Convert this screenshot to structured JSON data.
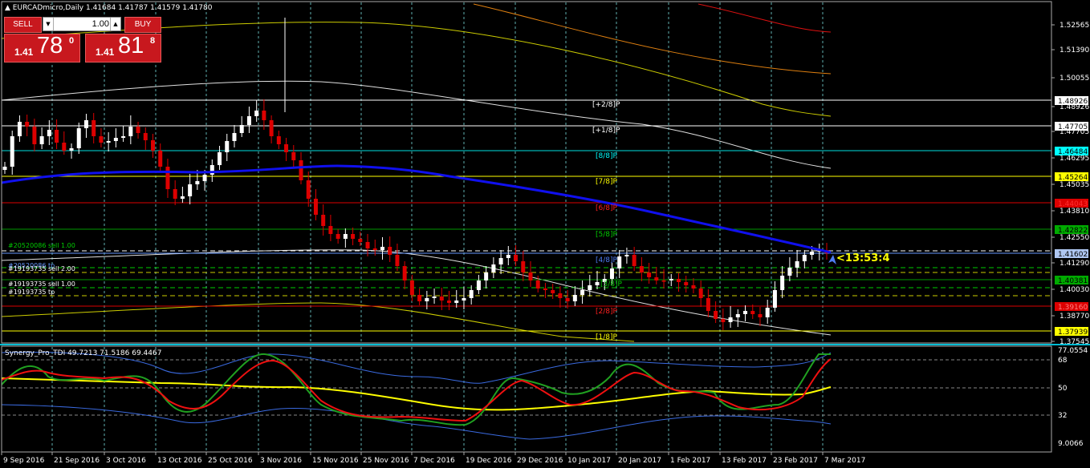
{
  "header": {
    "symbol_label": "EURCADmicro,Daily",
    "ohlc": "1.41684 1.41787 1.41579 1.41780"
  },
  "trade_panel": {
    "sell_label": "SELL",
    "buy_label": "BUY",
    "lot": "1.00",
    "sell_prefix": "1.41",
    "sell_big": "78",
    "sell_sup": "0",
    "buy_prefix": "1.41",
    "buy_big": "81",
    "buy_sup": "8"
  },
  "price_axis": {
    "ticks": [
      "1.52565",
      "1.51390",
      "1.50055",
      "1.48926",
      "1.47705",
      "1.46295",
      "1.45035",
      "1.43810",
      "1.42550",
      "1.41290",
      "1.40030",
      "1.38770",
      "1.37545"
    ],
    "badges": [
      {
        "label": "1.48926",
        "bg": "#ffffff",
        "fg": "#000000"
      },
      {
        "label": "1.47705",
        "bg": "#ffffff",
        "fg": "#000000"
      },
      {
        "label": "1.46484",
        "bg": "#00ffff",
        "fg": "#000000"
      },
      {
        "label": "1.45264",
        "bg": "#ffff00",
        "fg": "#000000"
      },
      {
        "label": "1.44043",
        "bg": "#dd0000",
        "fg": "#ff3030"
      },
      {
        "label": "1.42822",
        "bg": "#00aa00",
        "fg": "#000000"
      },
      {
        "label": "1.41602",
        "bg": "#aec6f0",
        "fg": "#000000"
      },
      {
        "label": "1.40381",
        "bg": "#00aa00",
        "fg": "#000000"
      },
      {
        "label": "1.39160",
        "bg": "#dd0000",
        "fg": "#ff8080"
      },
      {
        "label": "1.37939",
        "bg": "#ffff00",
        "fg": "#000000"
      }
    ]
  },
  "murrey_levels": [
    {
      "label": "[+2/8]P",
      "color": "#ffffff"
    },
    {
      "label": "[+1/8]P",
      "color": "#ffffff"
    },
    {
      "label": "[8/8]P",
      "color": "#00ffff"
    },
    {
      "label": "[7/8]P",
      "color": "#ffff00"
    },
    {
      "label": "[6/8]P",
      "color": "#ff2020"
    },
    {
      "label": "[5/8]P",
      "color": "#00cc00"
    },
    {
      "label": "[4/8]P",
      "color": "#4f7cf0"
    },
    {
      "label": "[3/8]P",
      "color": "#00cc00"
    },
    {
      "label": "[2/8]P",
      "color": "#ff2020"
    },
    {
      "label": "[1/8]P",
      "color": "#ffff00"
    }
  ],
  "order_labels": [
    {
      "label": "#20520086 sell 1.00",
      "color": "#00cc00"
    },
    {
      "label": "#20520086 tp",
      "color": "#6699ff"
    },
    {
      "label": "#19193735 sell 2.00",
      "color": "#ffffff"
    },
    {
      "label": "#19193735 sell 1.00",
      "color": "#ffffff"
    },
    {
      "label": "#19193735 tp",
      "color": "#ffffff"
    }
  ],
  "countdown": "<13:53:4",
  "indicator": {
    "label": "Synergy_Pro_TDI 49.7213 71.5186 69.4467",
    "ticks": [
      "77.0554",
      "68",
      "50",
      "32",
      "9.0066"
    ]
  },
  "time_axis": [
    "9 Sep 2016",
    "21 Sep 2016",
    "3 Oct 2016",
    "13 Oct 2016",
    "25 Oct 2016",
    "3 Nov 2016",
    "15 Nov 2016",
    "25 Nov 2016",
    "7 Dec 2016",
    "19 Dec 2016",
    "29 Dec 2016",
    "10 Jan 2017",
    "20 Jan 2017",
    "1 Feb 2017",
    "13 Feb 2017",
    "23 Feb 2017",
    "7 Mar 2017"
  ],
  "colors": {
    "bull": "#ffffff",
    "bear": "#dd0000",
    "ma": "#1010ee",
    "grid": "#5fb0b0",
    "tdi_red": "#ee1010",
    "tdi_green": "#20a020",
    "tdi_yellow": "#ffff00",
    "tdi_band": "#3a6ae0"
  }
}
